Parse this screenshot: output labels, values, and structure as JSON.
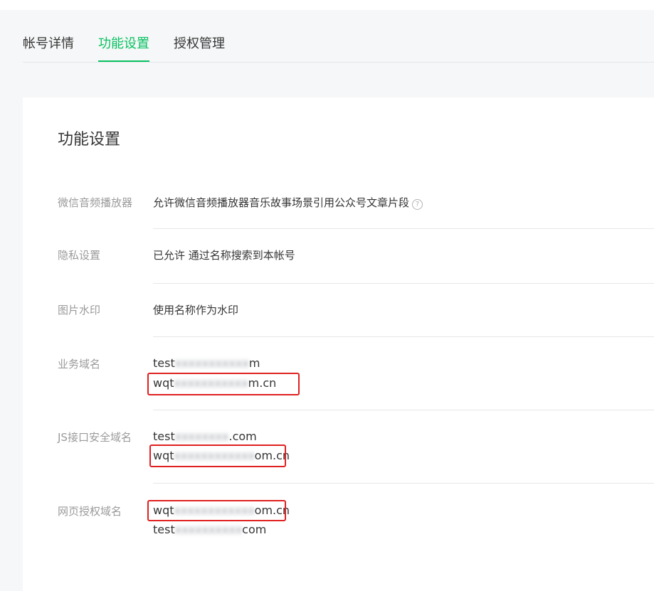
{
  "tabs": [
    {
      "label": "帐号详情",
      "active": false
    },
    {
      "label": "功能设置",
      "active": true
    },
    {
      "label": "授权管理",
      "active": false
    }
  ],
  "card": {
    "title": "功能设置",
    "rows": {
      "audio_player": {
        "label": "微信音频播放器",
        "value": "允许微信音频播放器音乐故事场景引用公众号文章片段",
        "help_icon": "?"
      },
      "privacy": {
        "label": "隐私设置",
        "value": "已允许 通过名称搜索到本帐号"
      },
      "watermark": {
        "label": "图片水印",
        "value": "使用名称作为水印"
      },
      "business_domain": {
        "label": "业务域名",
        "domains": [
          {
            "prefix": "test",
            "masked": "xxxxxxxxxxx",
            "suffix": "m"
          },
          {
            "prefix": "wqt",
            "masked": "xxxxxxxxxxx",
            "suffix": "m.cn"
          }
        ]
      },
      "js_domain": {
        "label": "JS接口安全域名",
        "domains": [
          {
            "prefix": "test",
            "masked": "xxxxxxxx",
            "suffix": ".com"
          },
          {
            "prefix": "wqt",
            "masked": "xxxxxxxxxxxx",
            "suffix": "om.cn"
          }
        ]
      },
      "oauth_domain": {
        "label": "网页授权域名",
        "domains": [
          {
            "prefix": "wqt",
            "masked": "xxxxxxxxxxxx",
            "suffix": "om.cn"
          },
          {
            "prefix": "test",
            "masked": "xxxxxxxxxx",
            "suffix": "com"
          }
        ]
      }
    }
  },
  "colors": {
    "accent": "#07c160",
    "highlight": "#e02020"
  }
}
